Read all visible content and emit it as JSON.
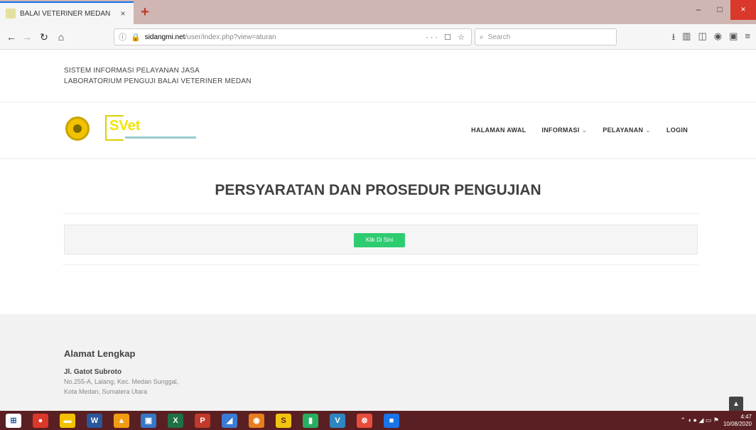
{
  "browser": {
    "tab_title": "BALAI VETERINER MEDAN",
    "tab_close": "×",
    "new_tab": "+",
    "url_host": "sidangmi.net",
    "url_path": "/user/index.php?view=aturan",
    "url_actions": "··· ☐ ☆",
    "search_placeholder": "Search",
    "window_min": "–",
    "window_max": "□",
    "window_close": "×"
  },
  "page": {
    "topbar_line1": "SISTEM INFORMASI PELAYANAN JASA",
    "topbar_line2": "LABORATORIUM PENGUJI BALAI VETERINER MEDAN",
    "logo_text": "SVet",
    "menu": [
      {
        "label": "HALAMAN AWAL"
      },
      {
        "label": "INFORMASI"
      },
      {
        "label": "PELAYANAN"
      },
      {
        "label": "LOGIN"
      }
    ],
    "title": "PERSYARATAN DAN PROSEDUR PENGUJIAN",
    "panel_button": "Klik Di Sini",
    "footer": {
      "title": "Alamat Lengkap",
      "street": "Jl. Gatot Subroto",
      "address1": "No.255-A, Lalang, Kec. Medan Sunggal,",
      "address2": "Kota Medan, Sumatera Utara"
    },
    "scroll_top": "▲"
  },
  "taskbar": {
    "clock_time": "4:47",
    "clock_date": "10/08/2020"
  }
}
